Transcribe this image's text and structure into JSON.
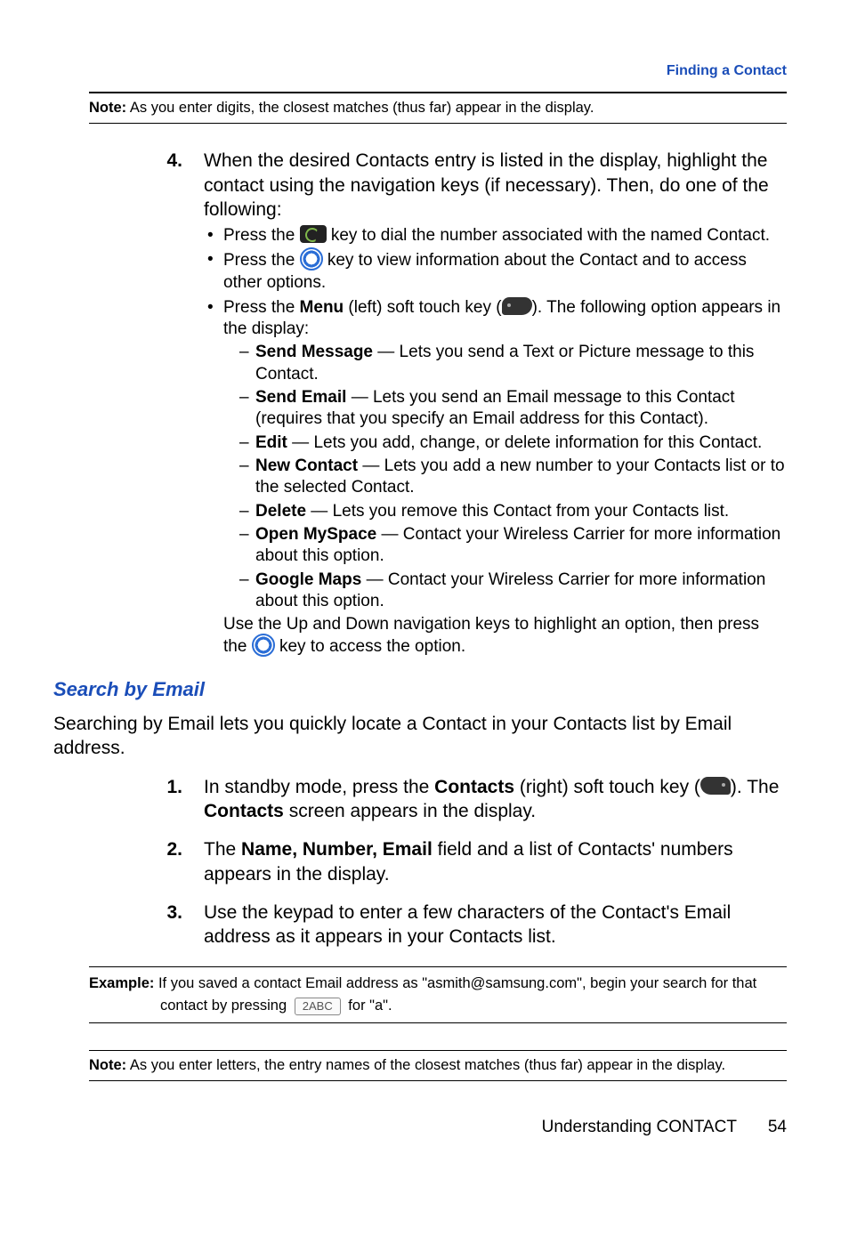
{
  "breadcrumb": "Finding a Contact",
  "note1": {
    "label": "Note:",
    "text": "As you enter digits, the closest matches (thus far) appear in the display."
  },
  "step4": {
    "num": "4.",
    "text": "When the desired Contacts entry is listed in the display, highlight the contact using the navigation keys (if necessary). Then, do one of the following:",
    "b1a": "Press the ",
    "b1b": " key to dial the number associated with the named Contact.",
    "b2a": "Press the ",
    "b2b": " key to view information about the Contact and to access other options.",
    "b3a": "Press the ",
    "b3b": "Menu",
    "b3c": " (left) soft touch key (",
    "b3d": "). The following option appears in the display:",
    "opts": {
      "sendMsg": {
        "name": "Send Message",
        "desc": " — Lets you send a Text or Picture message to this Contact."
      },
      "sendEmail": {
        "name": "Send Email",
        "desc": " — Lets you send an Email message to this Contact (requires that you specify an Email address for this Contact)."
      },
      "edit": {
        "name": "Edit",
        "desc": " — Lets you add, change, or delete information for this Contact."
      },
      "newContact": {
        "name": "New Contact",
        "desc": " — Lets you add a new number to your Contacts list or to the selected Contact."
      },
      "deleteOpt": {
        "name": "Delete",
        "desc": " — Lets you remove this Contact from your Contacts list."
      },
      "openMyspace": {
        "name": "Open MySpace",
        "desc": " — Contact your Wireless Carrier for more information about this option."
      },
      "googleMaps": {
        "name": "Google Maps",
        "desc": " — Contact your Wireless Carrier for more information about this option."
      }
    },
    "tail1": "Use the Up and Down navigation keys to highlight an option, then press the ",
    "tail2": " key to access the option."
  },
  "heading": "Search by Email",
  "introPara": "Searching by Email lets you quickly locate a Contact in your Contacts list by Email address.",
  "step1": {
    "num": "1.",
    "a": "In standby mode, press the ",
    "b": "Contacts",
    "c": " (right) soft touch key (",
    "d": "). The ",
    "e": "Contacts",
    "f": " screen appears in the display."
  },
  "step2": {
    "num": "2.",
    "a": "The ",
    "b": "Name, Number, Email",
    "c": " field and a list of Contacts' numbers appears in the display."
  },
  "step3": {
    "num": "3.",
    "text": "Use the keypad to enter a few characters of the Contact's Email address as it appears in your Contacts list."
  },
  "example": {
    "label": "Example:",
    "line1": "If you saved a contact Email address as \"asmith@samsung.com\", begin your search for that",
    "line2a": "contact by pressing ",
    "keylabel": "2ABC",
    "line2b": " for \"a\"."
  },
  "note2": {
    "label": "Note:",
    "text": "As you enter letters, the entry names of the closest matches (thus far) appear in the display."
  },
  "footer": {
    "section": "Understanding CONTACT",
    "page": "54"
  }
}
